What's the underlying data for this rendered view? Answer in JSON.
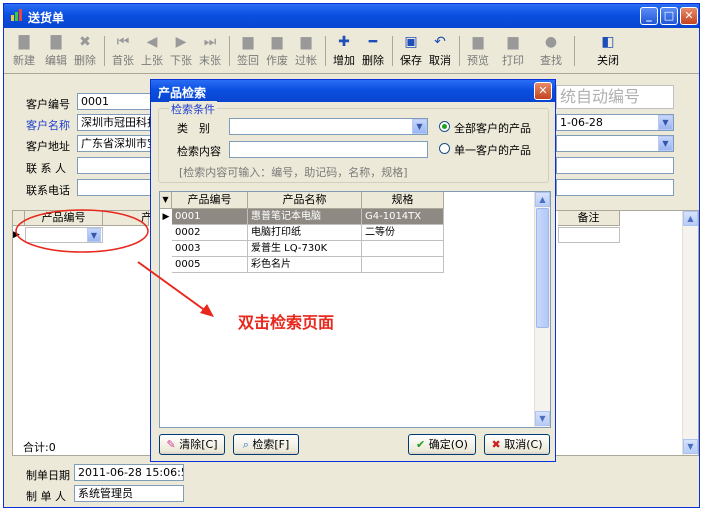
{
  "window": {
    "title": "送货单"
  },
  "toolbar": {
    "buttons": [
      {
        "label": "新建",
        "icon": "new-doc-icon",
        "enabled": false
      },
      {
        "label": "编辑",
        "icon": "edit-icon",
        "enabled": false
      },
      {
        "label": "删除",
        "icon": "delete-x-icon",
        "enabled": false
      },
      {
        "label": "首张",
        "icon": "first-record-icon",
        "enabled": false
      },
      {
        "label": "上张",
        "icon": "prev-record-icon",
        "enabled": false
      },
      {
        "label": "下张",
        "icon": "next-record-icon",
        "enabled": false
      },
      {
        "label": "末张",
        "icon": "last-record-icon",
        "enabled": false
      },
      {
        "label": "签回",
        "icon": "sign-back-icon",
        "enabled": false
      },
      {
        "label": "作废",
        "icon": "void-icon",
        "enabled": false
      },
      {
        "label": "过帐",
        "icon": "post-book-icon",
        "enabled": false
      },
      {
        "label": "增加",
        "icon": "plus-icon",
        "enabled": true
      },
      {
        "label": "删除",
        "icon": "minus-icon",
        "enabled": true
      },
      {
        "label": "保存",
        "icon": "save-disk-icon",
        "enabled": true
      },
      {
        "label": "取消",
        "icon": "undo-icon",
        "enabled": true
      },
      {
        "label": "预览",
        "icon": "preview-icon",
        "enabled": false
      },
      {
        "label": "打印",
        "icon": "printer-icon",
        "enabled": false
      },
      {
        "label": "查找",
        "icon": "find-icon",
        "enabled": false
      },
      {
        "label": "关闭",
        "icon": "close-door-icon",
        "enabled": true
      }
    ]
  },
  "form": {
    "customer_code_label": "客户编号",
    "customer_code": "0001",
    "customer_name_label": "客户名称",
    "customer_name": "深圳市冠田科技",
    "customer_address_label": "客户地址",
    "customer_address": "广东省深圳市宝",
    "contact_label": "联 系 人",
    "phone_label": "联系电话",
    "auto_number_text": "统自动编号",
    "date_partial": "1-06-28"
  },
  "grid": {
    "col_product_code": "产品编号",
    "col_product_partial": "产",
    "col_remark": "备注",
    "total_label": "合计:0"
  },
  "footer": {
    "created_date_label": "制单日期",
    "created_date": "2011-06-28 15:06:55",
    "creator_label": "制 单 人",
    "creator": "系统管理员"
  },
  "dialog": {
    "title": "产品检索",
    "group_title": "检索条件",
    "category_label": "类　别",
    "search_content_label": "检索内容",
    "hint": "[检索内容可输入：编号，助记码，名称，规格]",
    "radio_all": "全部客户的产品",
    "radio_single": "单一客户的产品",
    "columns": [
      "产品编号",
      "产品名称",
      "规格"
    ],
    "rows": [
      {
        "code": "0001",
        "name": "惠普笔记本电脑",
        "spec": "G4-1014TX"
      },
      {
        "code": "0002",
        "name": "电脑打印纸",
        "spec": "二等份"
      },
      {
        "code": "0003",
        "name": "爱普生 LQ-730K",
        "spec": ""
      },
      {
        "code": "0005",
        "name": "彩色名片",
        "spec": ""
      }
    ],
    "btn_clear": "清除[C]",
    "btn_search": "检索[F]",
    "btn_ok": "确定(O)",
    "btn_cancel": "取消(C)"
  },
  "annotation": {
    "text": "双击检索页面",
    "color": "#e8281c"
  }
}
